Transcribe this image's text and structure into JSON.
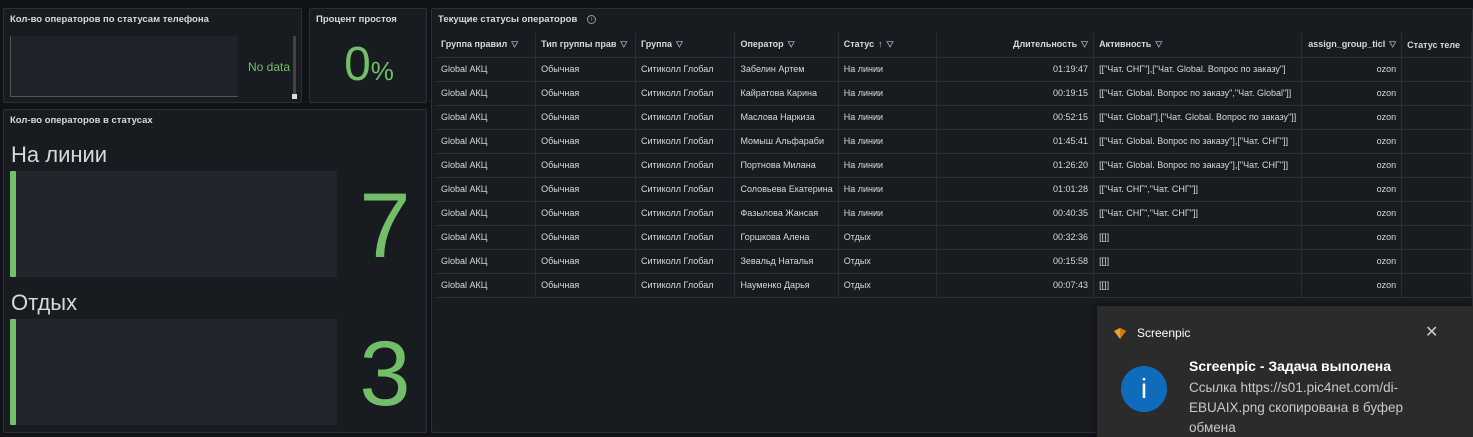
{
  "panels": {
    "phone_status": {
      "title": "Кол-во операторов по статусам телефона",
      "no_data": "No data"
    },
    "idle_percent": {
      "title": "Процент простоя",
      "value": "0",
      "unit": "%"
    },
    "operators_in_status": {
      "title": "Кол-во операторов в статусах",
      "stats": [
        {
          "label": "На линии",
          "value": "7"
        },
        {
          "label": "Отдых",
          "value": "3"
        }
      ],
      "accent_color": "#73bf69"
    },
    "current_statuses": {
      "title": "Текущие статусы операторов",
      "info_icon": "info-icon",
      "columns": [
        "Группа правил",
        "Тип группы прав",
        "Группа",
        "Оператор",
        "Статус",
        "Длительность",
        "Активность",
        "assign_group_ticl",
        "Статус теле"
      ],
      "rows": [
        [
          "Global АКЦ",
          "Обычная",
          "Ситиколл Глобал",
          "Забелин Артем",
          "На линии",
          "01:19:47",
          "[[\"Чат. СНГ\"],[\"Чат. Global. Вопрос по заказу\"]",
          "ozon",
          ""
        ],
        [
          "Global АКЦ",
          "Обычная",
          "Ситиколл Глобал",
          "Кайратова Карина",
          "На линии",
          "00:19:15",
          "[[\"Чат. Global. Вопрос по заказу\",\"Чат. Global\"]]",
          "ozon",
          ""
        ],
        [
          "Global АКЦ",
          "Обычная",
          "Ситиколл Глобал",
          "Маслова Наркиза",
          "На линии",
          "00:52:15",
          "[[\"Чат. Global\"],[\"Чат. Global. Вопрос по заказу\"]]",
          "ozon",
          ""
        ],
        [
          "Global АКЦ",
          "Обычная",
          "Ситиколл Глобал",
          "Момыш Альфараби",
          "На линии",
          "01:45:41",
          "[[\"Чат. Global. Вопрос по заказу\"],[\"Чат. СНГ\"]]",
          "ozon",
          ""
        ],
        [
          "Global АКЦ",
          "Обычная",
          "Ситиколл Глобал",
          "Портнова Милана",
          "На линии",
          "01:26:20",
          "[[\"Чат. Global. Вопрос по заказу\"],[\"Чат. СНГ\"]]",
          "ozon",
          ""
        ],
        [
          "Global АКЦ",
          "Обычная",
          "Ситиколл Глобал",
          "Соловьева Екатерина",
          "На линии",
          "01:01:28",
          "[[\"Чат. СНГ\",\"Чат. СНГ\"]]",
          "ozon",
          ""
        ],
        [
          "Global АКЦ",
          "Обычная",
          "Ситиколл Глобал",
          "Фазылова Жансая",
          "На линии",
          "00:40:35",
          "[[\"Чат. СНГ\",\"Чат. СНГ\"]]",
          "ozon",
          ""
        ],
        [
          "Global АКЦ",
          "Обычная",
          "Ситиколл Глобал",
          "Горшкова Алена",
          "Отдых",
          "00:32:36",
          "[[]]",
          "ozon",
          ""
        ],
        [
          "Global АКЦ",
          "Обычная",
          "Ситиколл Глобал",
          "Зевальд Наталья",
          "Отдых",
          "00:15:58",
          "[[]]",
          "ozon",
          ""
        ],
        [
          "Global АКЦ",
          "Обычная",
          "Ситиколл Глобал",
          "Науменко Дарья",
          "Отдых",
          "00:07:43",
          "[[]]",
          "ozon",
          ""
        ]
      ]
    }
  },
  "toast": {
    "app_name": "Screenpic",
    "title": "Screenpic - Задача выполена",
    "body": "Ссылка https://s01.pic4net.com/di-EBUAIX.png скопирована в буфер обмена",
    "icon": "info-icon",
    "accent_color": "#0f6cbd"
  }
}
